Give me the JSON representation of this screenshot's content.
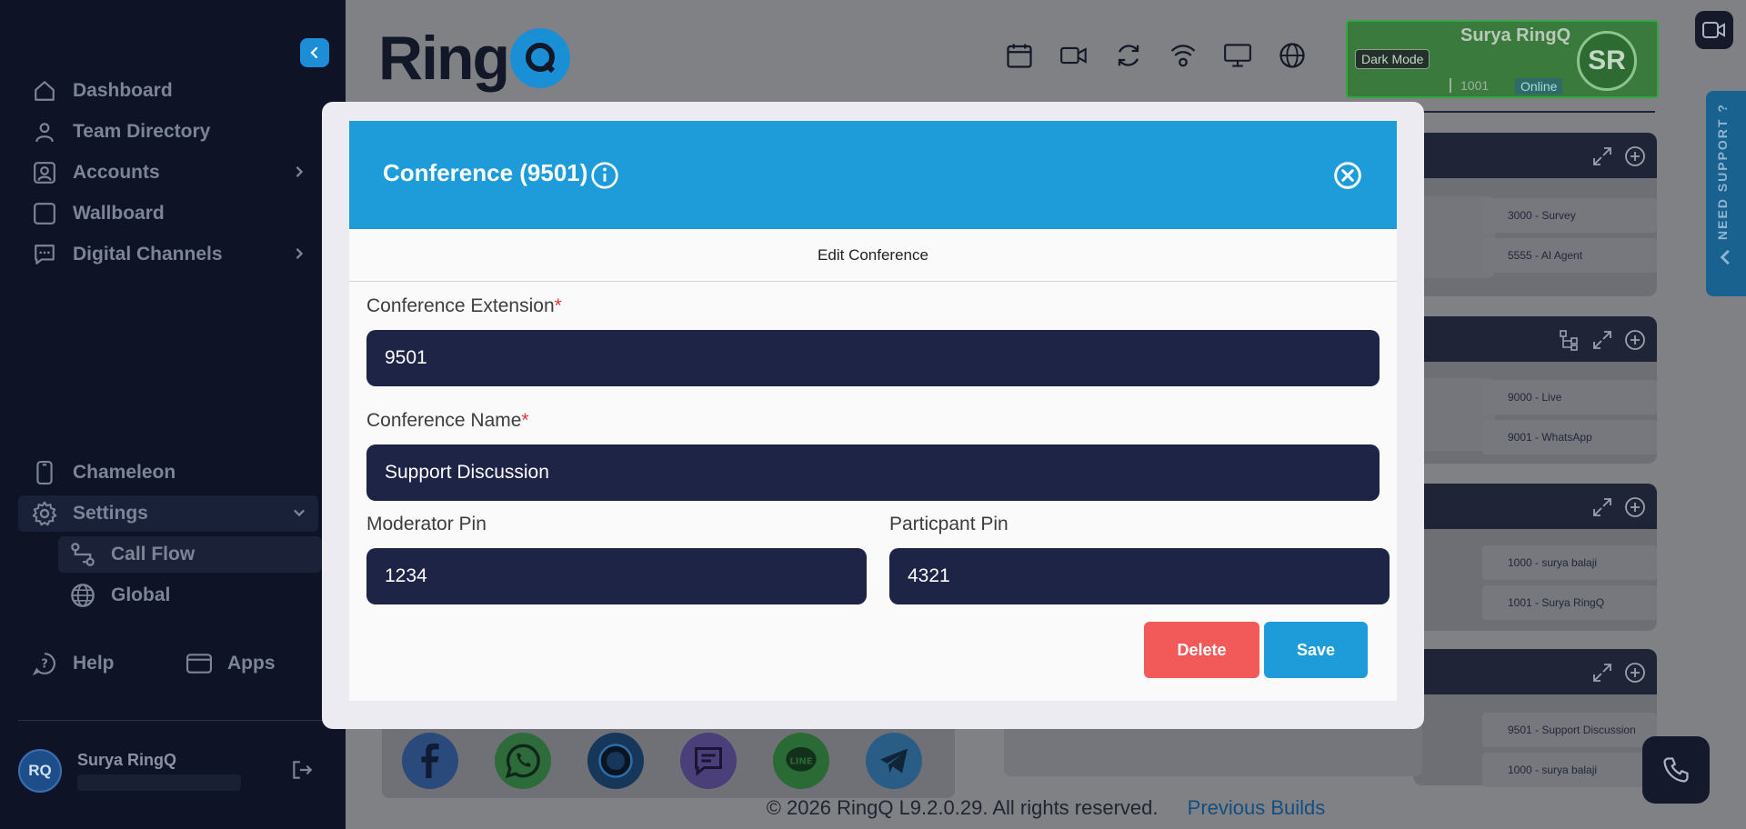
{
  "sidebar": {
    "items": [
      {
        "label": "Dashboard",
        "icon": "home-icon"
      },
      {
        "label": "Team Directory",
        "icon": "user-icon"
      },
      {
        "label": "Accounts",
        "icon": "account-icon"
      },
      {
        "label": "Wallboard",
        "icon": "square-icon"
      },
      {
        "label": "Digital Channels",
        "icon": "chat-icon"
      },
      {
        "label": "Chameleon",
        "icon": "phone-device-icon"
      },
      {
        "label": "Settings",
        "icon": "gear-icon"
      }
    ],
    "sub_items": [
      {
        "label": "Call Flow",
        "icon": "flow-icon"
      },
      {
        "label": "Global",
        "icon": "globe-icon"
      }
    ],
    "bottom": {
      "help": "Help",
      "apps": "Apps"
    },
    "user": {
      "name": "Surya RingQ",
      "initials": "RQ"
    }
  },
  "header": {
    "logo_text": "Ring",
    "profile": {
      "name": "Surya RingQ",
      "dark_mode": "Dark Mode",
      "extension": "1001",
      "status": "Online",
      "initials": "SR",
      "color": "#3a7a3d"
    }
  },
  "background": {
    "cards": [
      {
        "items": [
          "3000 - Survey",
          "5555 - AI Agent"
        ]
      },
      {
        "items": [
          "9000 - Live",
          "9001 - WhatsApp"
        ]
      },
      {
        "items": [
          "1000 - surya balaji",
          "1001 - Surya RingQ"
        ]
      },
      {
        "items": [
          "9501 - Support Discussion",
          "1000 - surya balaji"
        ]
      }
    ],
    "support_tab": "NEED SUPPORT ?",
    "footer": {
      "copyright": "© 2026 RingQ L9.2.0.29. All rights reserved.",
      "link": "Previous Builds"
    }
  },
  "modal": {
    "title": "Conference (9501)",
    "subtitle": "Edit Conference",
    "fields": {
      "extension": {
        "label": "Conference Extension",
        "required": "*",
        "value": "9501"
      },
      "name": {
        "label": "Conference Name",
        "required": "*",
        "value": "Support Discussion"
      },
      "moderator_pin": {
        "label": "Moderator Pin",
        "value": "1234"
      },
      "participant_pin": {
        "label": "Particpant Pin",
        "value": "4321"
      }
    },
    "buttons": {
      "delete": "Delete",
      "save": "Save"
    },
    "colors": {
      "header": "#1d9cd9",
      "delete": "#f25a5a",
      "input": "#1e2446"
    }
  }
}
